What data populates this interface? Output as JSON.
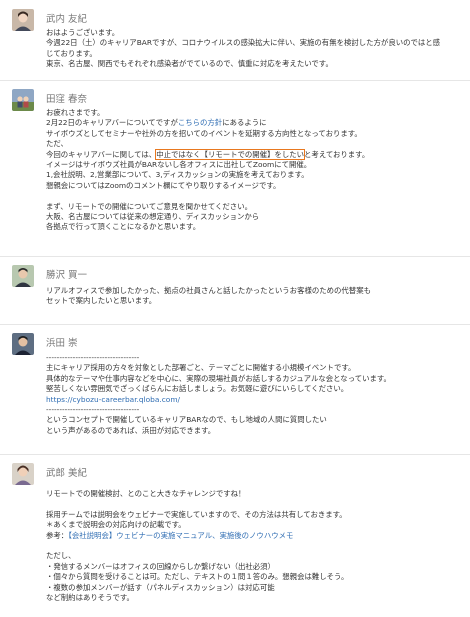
{
  "posts": [
    {
      "author": "武内 友紀",
      "lines": [
        "おはようございます。",
        "今週22日（土）のキャリアBARですが、コロナウイルスの感染拡大に伴い、実施の有無を検討した方が良いのではと感",
        "じております。",
        "東京、名古屋、関西でもそれぞれ感染者がでているので、慎重に対応を考えたいです。"
      ]
    },
    {
      "author": "田窪 春奈",
      "lines": [
        "お疲れさまです。"
      ],
      "line2_before": "2月22日のキャリアバーについてですが",
      "line2_link": "こちらの方針",
      "line2_after": "にあるように",
      "lines_b": [
        "サイボウズとしてセミナーや社外の方を招いてのイベントを延期する方向性となっております。",
        "ただ、"
      ],
      "line_hl_before": "今回のキャリアバーに関しては、",
      "line_hl_mark": "中止ではなく【リモートでの開催】をしたい",
      "line_hl_after": "と考えております。",
      "lines_c": [
        "イメージはサイボウズ社員がBARないし各オフィスに出社してZoomにて開催。",
        "1,会社説明、2,営業部について、3,ディスカッションの実施を考えております。",
        "懇親会についてはZoomのコメント欄にてやり取りするイメージです。"
      ],
      "lines_d": [
        "まず、リモートでの開催についてご意見を聞かせてください。",
        "大阪、名古屋については従来の想定通り、ディスカッションから",
        "各拠点で行って頂くことになるかと思います。"
      ]
    },
    {
      "author": "勝沢 買一",
      "lines": [
        "リアルオフィスで参加したかった、拠点の社員さんと話したかったというお客様のための代替案も",
        "セットで案内したいと思います。"
      ]
    },
    {
      "author": "浜田 崇",
      "lines": [
        "-----------------------------------",
        "主にキャリア採用の方々を対象とした部署ごと、テーマごとに開催する小規模イベントです。",
        "具体的なテーマや仕事内容などを中心に、実際の現場社員がお話しするカジュアルな会となっています。",
        "堅苦しくない雰囲気でざっくばらんにお話しましょう。お気軽に遊びにいらしてください。"
      ],
      "url": "https://cybozu-careerbar.qloba.com/",
      "lines_b": [
        "-----------------------------------",
        "というコンセプトで開催しているキャリアBARなので、もし地域の人間に質問したい",
        "という声があるのであれば、浜田が対応できます。"
      ]
    },
    {
      "author": "武郎 美紀",
      "lines": [
        "リモートでの開催検討、とのこと大きなチャレンジですね！"
      ],
      "lines_b": [
        "採用チームでは説明会をウェビナーで実施していますので、その方法は共有しておきます。",
        "＊あくまで説明会の対応向けの記載です。"
      ],
      "ref_label": "参考：",
      "ref_link": "【会社説明会】ウェビナーの実施マニュアル、実施後のノウハウメモ",
      "lines_c": [
        "ただし、",
        "・発信するメンバーはオフィスの回線からしか繋げない（出社必須）",
        "・個々から質問を受けることは可。ただし、テキストの１問１答のみ。懇親会は難しそう。",
        "・複数の参加メンバーが話す（パネルディスカッション）は対応可能",
        "など制約はありそうです。"
      ]
    }
  ],
  "colors": {
    "link": "#2f6db3",
    "highlight_border": "#e8781f",
    "author": "#777777",
    "text": "#333333"
  },
  "icons": [
    "avatar",
    "avatar",
    "avatar",
    "avatar",
    "avatar"
  ]
}
